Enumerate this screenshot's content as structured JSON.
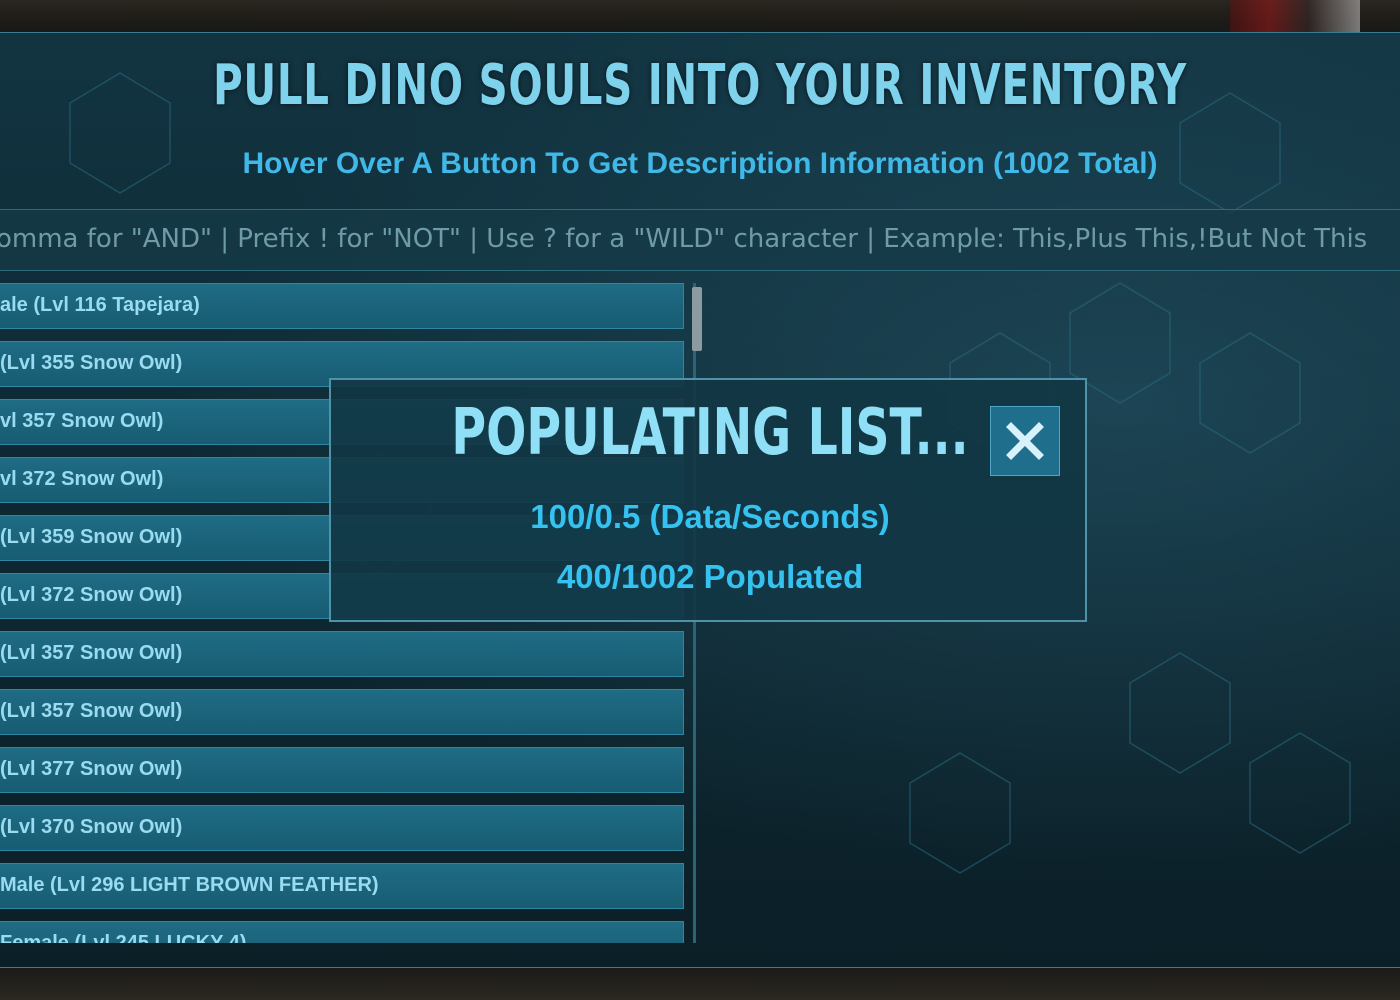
{
  "header": {
    "title": "PULL DINO SOULS INTO YOUR INVENTORY",
    "subtitle": "Hover Over A Button To Get Description Information (1002 Total)"
  },
  "search": {
    "hint": "omma for \"AND\" |  Prefix ! for \"NOT\" | Use ? for a \"WILD\" character | Example: This,Plus This,!But Not This"
  },
  "list": {
    "items": [
      "ale (Lvl 116 Tapejara)",
      " (Lvl 355 Snow Owl)",
      "vl 357 Snow Owl)",
      "vl 372 Snow Owl)",
      " (Lvl 359 Snow Owl)",
      " (Lvl 372 Snow Owl)",
      " (Lvl 357 Snow Owl)",
      " (Lvl 357 Snow Owl)",
      " (Lvl 377 Snow Owl)",
      " (Lvl 370 Snow Owl)",
      "Male (Lvl 296 LIGHT BROWN FEATHER)",
      "Female (Lvl 245 LUCKY 4)"
    ]
  },
  "modal": {
    "title": "POPULATING LIST...",
    "rate": "100/0.5 (Data/Seconds)",
    "progress": "400/1002 Populated",
    "close_icon": "close-icon"
  },
  "colors": {
    "accent": "#35c2f0",
    "title": "#7fd2ec",
    "panel": "#123441",
    "list_item": "#1f6c85"
  }
}
